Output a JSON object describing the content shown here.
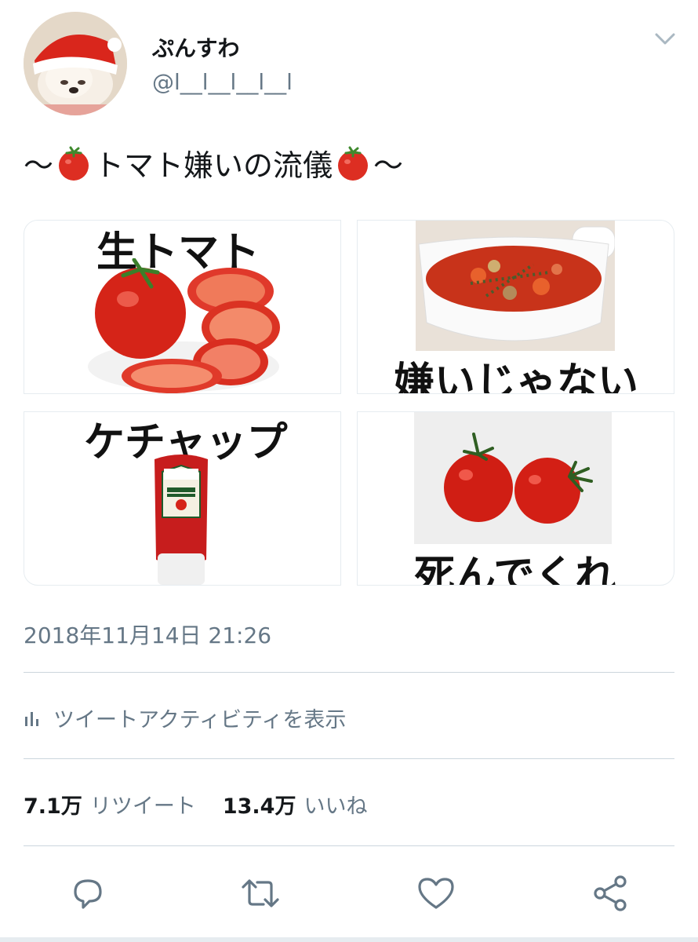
{
  "user": {
    "display_name": "ぷんすわ",
    "handle": "@l__l__l__l__l"
  },
  "tweet": {
    "text_prefix": "〜",
    "text_main": "トマト嫌いの流儀",
    "text_suffix": "〜",
    "timestamp": "2018年11月14日 21:26"
  },
  "media": [
    {
      "caption": "生トマト",
      "icon": "tomato-slices"
    },
    {
      "caption": "嫌いじゃない",
      "icon": "tomato-soup"
    },
    {
      "caption": "ケチャップ",
      "icon": "ketchup-bottle"
    },
    {
      "caption": "死んでくれ",
      "icon": "cherry-tomatoes"
    }
  ],
  "activity": {
    "label": "ツイートアクティビティを表示"
  },
  "stats": {
    "retweet_count": "7.1万",
    "retweet_label": "リツイート",
    "like_count": "13.4万",
    "like_label": "いいね"
  },
  "colors": {
    "text": "#14171a",
    "secondary": "#657786",
    "divider": "#ccd6dd",
    "tomato": "#d9261c"
  },
  "icons": [
    "chevron-down-icon",
    "tomato-icon",
    "activity-bars-icon",
    "reply-icon",
    "retweet-icon",
    "like-icon",
    "share-icon"
  ]
}
